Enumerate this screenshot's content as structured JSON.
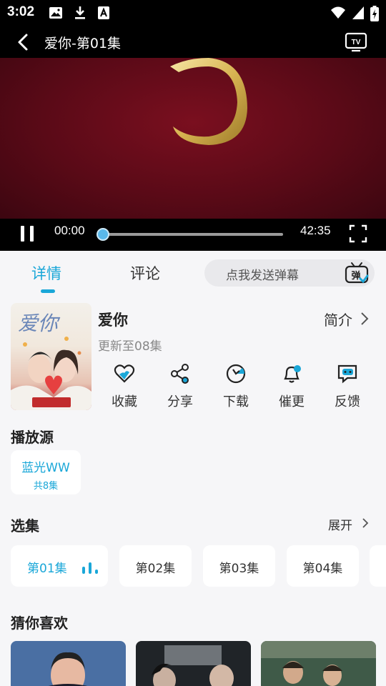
{
  "status_bar": {
    "time": "3:02"
  },
  "header": {
    "title": "爱你-第01集"
  },
  "player": {
    "current_time": "00:00",
    "total_time": "42:35",
    "progress_fraction": 0.0
  },
  "tabs": [
    {
      "label": "详情",
      "active": true
    },
    {
      "label": "评论",
      "active": false
    }
  ],
  "danmaku": {
    "placeholder": "点我发送弹幕",
    "icon_text": "弹"
  },
  "show": {
    "poster_title": "爱你",
    "title": "爱你",
    "update_status": "更新至08集",
    "intro_label": "简介"
  },
  "actions": [
    {
      "label": "收藏",
      "icon": "favorite-heart-icon"
    },
    {
      "label": "分享",
      "icon": "share-icon"
    },
    {
      "label": "下载",
      "icon": "download-icon"
    },
    {
      "label": "催更",
      "icon": "bell-remind-icon"
    },
    {
      "label": "反馈",
      "icon": "feedback-icon"
    }
  ],
  "sources_section": {
    "title": "播放源",
    "sources": [
      {
        "name": "蓝光WW",
        "count": "共8集"
      }
    ]
  },
  "episodes_section": {
    "title": "选集",
    "expand_label": "展开",
    "episodes": [
      {
        "label": "第01集",
        "active": true
      },
      {
        "label": "第02集",
        "active": false
      },
      {
        "label": "第03集",
        "active": false
      },
      {
        "label": "第04集",
        "active": false
      }
    ]
  },
  "recommend_section": {
    "title": "猜你喜欢"
  },
  "colors": {
    "accent": "#1aa7d8",
    "background": "#f6f6f8",
    "video_bg": "#5a0a17"
  }
}
